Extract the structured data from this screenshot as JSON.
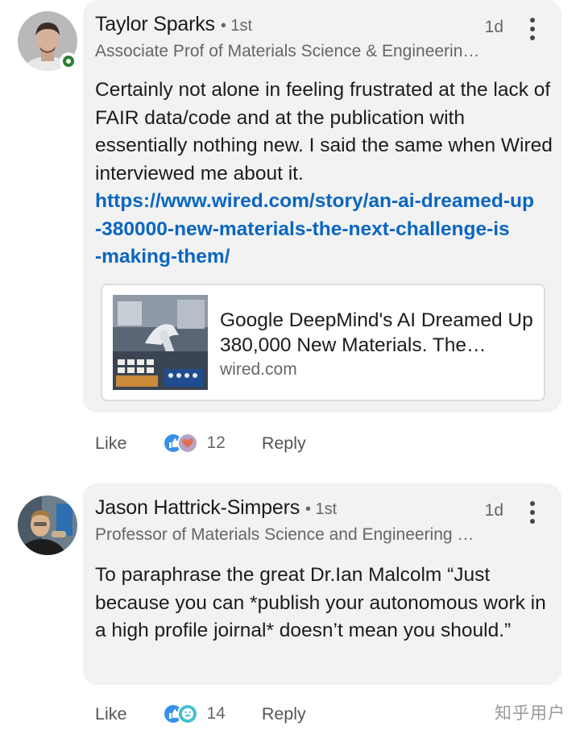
{
  "comments": [
    {
      "author": "Taylor Sparks",
      "degree": "• 1st",
      "headline": "Associate Prof of Materials Science & Engineerin…",
      "time": "1d",
      "body": "Certainly not alone in feeling frustrated at the lack of FAIR data/code and at the publication with essentially nothing new. I said the same when Wired interviewed me about it.",
      "link": "https://www.wired.com/story/an-ai-dreamed-up-380000-new-materials-the-next-challenge-is-making-them/",
      "link_lines": [
        "https://www.wired.com/story/an-ai-dreamed-up",
        "-380000-new-materials-the-next-challenge-is",
        "-making-them/"
      ],
      "preview": {
        "title": "Google DeepMind's AI Dreamed Up 380,000 New Materials. The…",
        "domain": "wired.com"
      },
      "online": true,
      "actions": {
        "like": "Like",
        "reaction_count": "12",
        "reply": "Reply"
      }
    },
    {
      "author": "Jason Hattrick-Simpers",
      "degree": "• 1st",
      "headline": "Professor of Materials Science and Engineering …",
      "time": "1d",
      "body": "To paraphrase the great Dr.Ian Malcolm “Just because you can *publish your autonomous work in a high profile joirnal* doesn’t mean you should.”",
      "actions": {
        "like": "Like",
        "reaction_count": "14",
        "reply": "Reply"
      }
    }
  ],
  "watermark": "知乎用户",
  "colors": {
    "link": "#0a66c2",
    "bubble": "#f2f2f2",
    "online": "#2e7d32",
    "like_reaction": "#378fe9",
    "love_reaction": "#df704d",
    "funny_reaction": "#44bfd3"
  },
  "icons": {
    "more": "more-vertical-icon",
    "reactions_1": [
      "like-reaction-icon",
      "love-reaction-icon"
    ],
    "reactions_2": [
      "like-reaction-icon",
      "funny-reaction-icon"
    ]
  }
}
